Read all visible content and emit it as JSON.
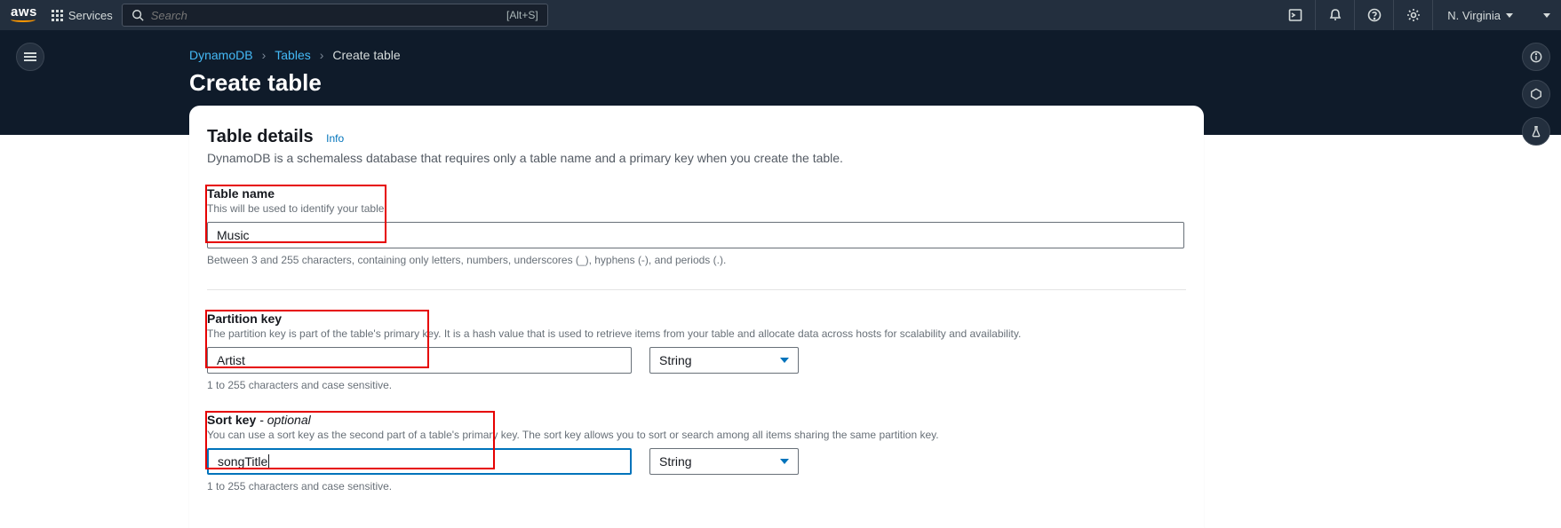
{
  "nav": {
    "logo": "aws",
    "services": "Services",
    "searchPlaceholder": "Search",
    "searchShortcut": "[Alt+S]",
    "region": "N. Virginia"
  },
  "breadcrumb": {
    "items": [
      "DynamoDB",
      "Tables",
      "Create table"
    ]
  },
  "pageTitle": "Create table",
  "panel": {
    "heading": "Table details",
    "info": "Info",
    "desc": "DynamoDB is a schemaless database that requires only a table name and a primary key when you create the table.",
    "tableName": {
      "label": "Table name",
      "sub": "This will be used to identify your table.",
      "value": "Music",
      "hint": "Between 3 and 255 characters, containing only letters, numbers, underscores (_), hyphens (-), and periods (.)."
    },
    "partitionKey": {
      "label": "Partition key",
      "sub": "The partition key is part of the table's primary key. It is a hash value that is used to retrieve items from your table and allocate data across hosts for scalability and availability.",
      "value": "Artist",
      "type": "String",
      "hint": "1 to 255 characters and case sensitive."
    },
    "sortKey": {
      "label": "Sort key",
      "optional": " - optional",
      "sub": "You can use a sort key as the second part of a table's primary key. The sort key allows you to sort or search among all items sharing the same partition key.",
      "value": "songTitle",
      "type": "String",
      "hint": "1 to 255 characters and case sensitive."
    }
  }
}
